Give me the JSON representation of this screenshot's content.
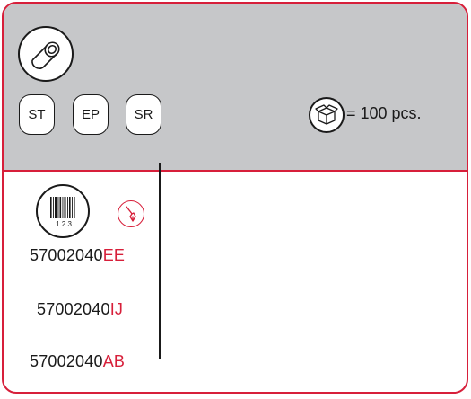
{
  "header": {
    "roll_icon": "roll-icon",
    "buttons": [
      {
        "label": "ST"
      },
      {
        "label": "EP"
      },
      {
        "label": "SR"
      }
    ],
    "box_icon": "box-icon",
    "quantity_text": "= 100 pcs."
  },
  "body": {
    "barcode_icon": "barcode-icon",
    "barcode_digits": "1 2 3",
    "pen_icon": "pen-icon",
    "codes": [
      {
        "base": "57002040",
        "suffix": "EE"
      },
      {
        "base": "57002040",
        "suffix": "IJ"
      },
      {
        "base": "57002040",
        "suffix": "AB"
      }
    ]
  },
  "colors": {
    "accent": "#d71f3a",
    "header_bg": "#c6c7c9",
    "text": "#1a1a1a"
  }
}
